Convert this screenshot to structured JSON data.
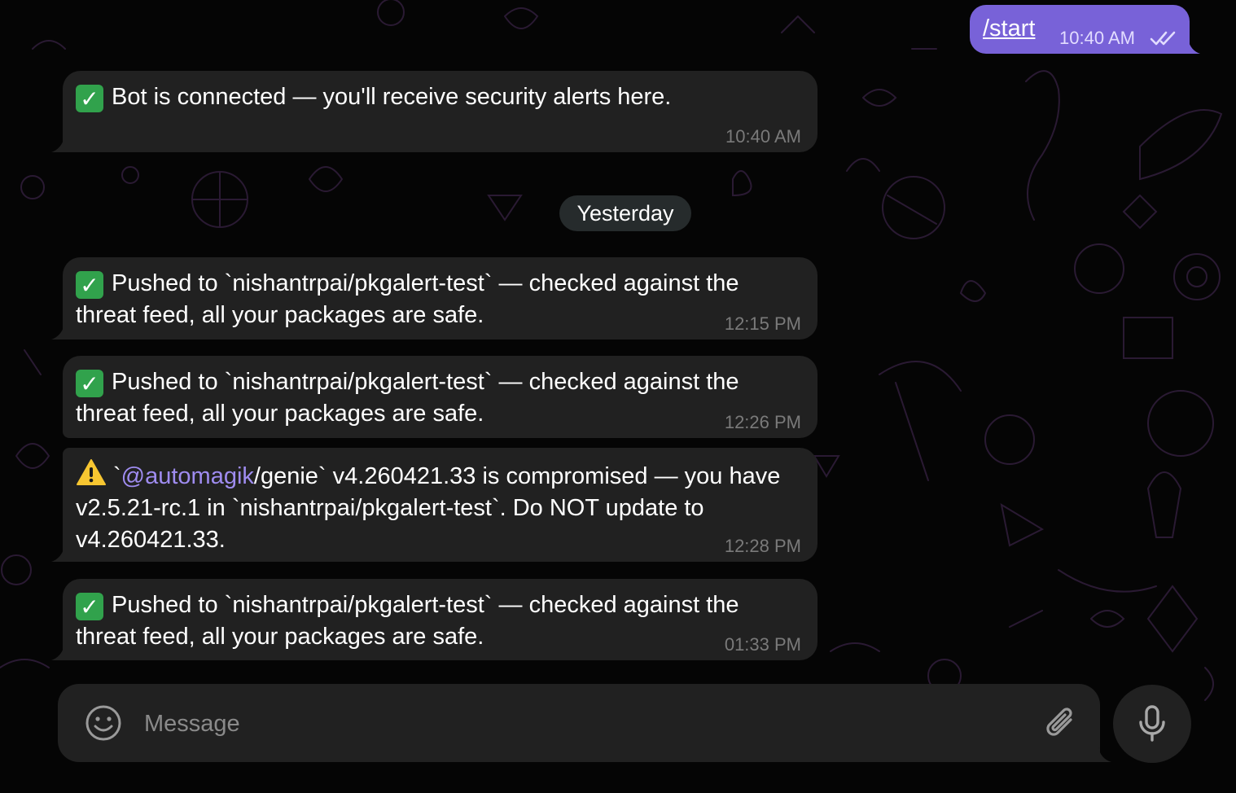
{
  "outgoing": {
    "text": "/start",
    "time": "10:40 AM",
    "status_icon": "double-check-icon"
  },
  "messages_top": {
    "connected": {
      "text": "Bot is connected — you'll receive security alerts here.",
      "time": "10:40 AM",
      "emoji": "check-mark-button"
    }
  },
  "date_separator": "Yesterday",
  "messages": [
    {
      "emoji": "check-mark-button",
      "text": "Pushed to `nishantrpai/pkgalert-test` — checked against the threat feed, all your packages are safe.",
      "time": "12:15 PM"
    },
    {
      "emoji": "check-mark-button",
      "text": "Pushed to `nishantrpai/pkgalert-test` — checked against the threat feed, all your packages are safe.",
      "time": "12:26 PM"
    },
    {
      "emoji": "warning",
      "pre": "`",
      "mention": "@automagik",
      "post": "/genie` v4.260421.33 is compromised — you have v2.5.21-rc.1 in `nishantrpai/pkgalert-test`. Do NOT update to v4.260421.33.",
      "time": "12:28 PM"
    },
    {
      "emoji": "check-mark-button",
      "text": "Pushed to `nishantrpai/pkgalert-test` — checked against the threat feed, all your packages are safe.",
      "time": "01:33 PM"
    }
  ],
  "composer": {
    "placeholder": "Message",
    "emoji_icon": "smiley-icon",
    "attach_icon": "paperclip-icon",
    "mic_icon": "microphone-icon"
  },
  "colors": {
    "background": "#050505",
    "bubble_in": "#212121",
    "bubble_out": "#7862d8",
    "mention": "#9f8cf0",
    "timestamp": "#7a7a7a",
    "date_pill": "#262b2c"
  }
}
